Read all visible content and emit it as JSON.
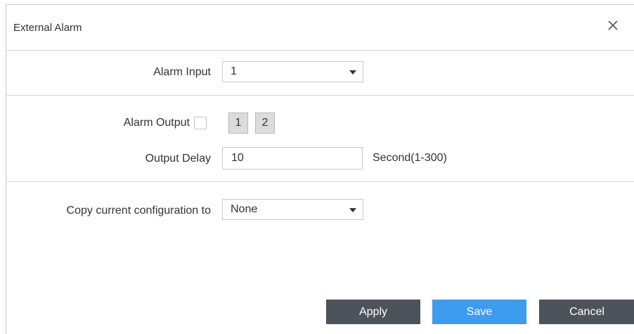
{
  "dialog": {
    "title": "External Alarm"
  },
  "alarm_input": {
    "label": "Alarm Input",
    "value": "1"
  },
  "alarm_output": {
    "label": "Alarm Output",
    "checked": false,
    "channels": [
      "1",
      "2"
    ]
  },
  "output_delay": {
    "label": "Output Delay",
    "value": "10",
    "unit": "Second(1-300)"
  },
  "copy_config": {
    "label": "Copy current configuration to",
    "value": "None"
  },
  "buttons": {
    "apply": "Apply",
    "save": "Save",
    "cancel": "Cancel"
  },
  "colors": {
    "primary": "#3d9bf0",
    "dark_button": "#4d535b"
  }
}
